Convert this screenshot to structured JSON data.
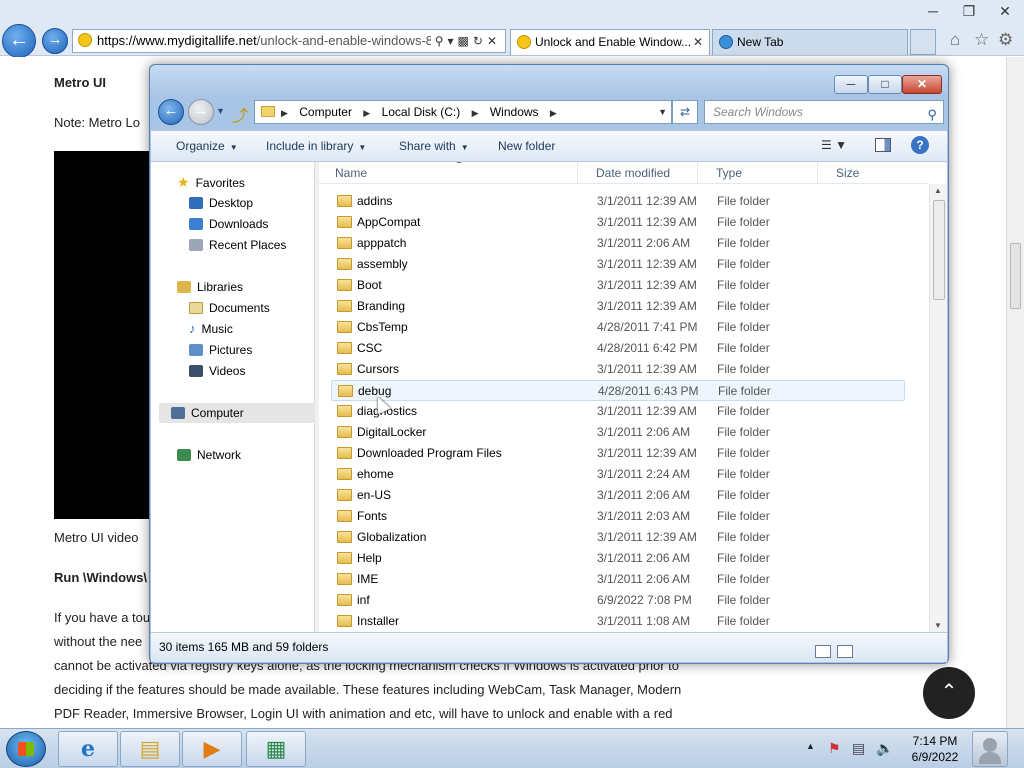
{
  "browser": {
    "address_domain": "https://www.mydigitallife.net",
    "address_path": "/unlock-and-enable-windows-8",
    "tabs": [
      {
        "label": "Unlock and Enable Window..."
      },
      {
        "label": "New Tab"
      }
    ]
  },
  "page": {
    "heading": "Metro UI",
    "note": "Note: Metro Lo",
    "video_caption": "Metro UI video",
    "run_text": "Run \\Windows\\",
    "para1": "If you have a tou",
    "para2": "without the nee",
    "para3": "cannot be activated via registry keys alone, as the locking mechanism checks if Windows is activated prior to",
    "para4": "deciding if the features should be made available. These features including WebCam, Task Manager, Modern",
    "para5": "PDF Reader, Immersive Browser, Login UI with animation and etc, will have to unlock and enable with a red"
  },
  "explorer": {
    "breadcrumb": [
      "Computer",
      "Local Disk (C:)",
      "Windows"
    ],
    "search_placeholder": "Search Windows",
    "toolbar": {
      "organize": "Organize",
      "include_in_library": "Include in library",
      "share_with": "Share with",
      "new_folder": "New folder"
    },
    "nav": {
      "favorites": "Favorites",
      "desktop": "Desktop",
      "downloads": "Downloads",
      "recent_places": "Recent Places",
      "libraries": "Libraries",
      "documents": "Documents",
      "music": "Music",
      "pictures": "Pictures",
      "videos": "Videos",
      "computer": "Computer",
      "network": "Network"
    },
    "columns": {
      "name": "Name",
      "date_modified": "Date modified",
      "type": "Type",
      "size": "Size"
    },
    "files": [
      {
        "name": "addins",
        "date": "3/1/2011 12:39 AM",
        "type": "File folder"
      },
      {
        "name": "AppCompat",
        "date": "3/1/2011 12:39 AM",
        "type": "File folder"
      },
      {
        "name": "apppatch",
        "date": "3/1/2011 2:06 AM",
        "type": "File folder"
      },
      {
        "name": "assembly",
        "date": "3/1/2011 12:39 AM",
        "type": "File folder"
      },
      {
        "name": "Boot",
        "date": "3/1/2011 12:39 AM",
        "type": "File folder"
      },
      {
        "name": "Branding",
        "date": "3/1/2011 12:39 AM",
        "type": "File folder"
      },
      {
        "name": "CbsTemp",
        "date": "4/28/2011 7:41 PM",
        "type": "File folder"
      },
      {
        "name": "CSC",
        "date": "4/28/2011 6:42 PM",
        "type": "File folder"
      },
      {
        "name": "Cursors",
        "date": "3/1/2011 12:39 AM",
        "type": "File folder"
      },
      {
        "name": "debug",
        "date": "4/28/2011 6:43 PM",
        "type": "File folder"
      },
      {
        "name": "diagnostics",
        "date": "3/1/2011 12:39 AM",
        "type": "File folder"
      },
      {
        "name": "DigitalLocker",
        "date": "3/1/2011 2:06 AM",
        "type": "File folder"
      },
      {
        "name": "Downloaded Program Files",
        "date": "3/1/2011 12:39 AM",
        "type": "File folder"
      },
      {
        "name": "ehome",
        "date": "3/1/2011 2:24 AM",
        "type": "File folder"
      },
      {
        "name": "en-US",
        "date": "3/1/2011 2:06 AM",
        "type": "File folder"
      },
      {
        "name": "Fonts",
        "date": "3/1/2011 2:03 AM",
        "type": "File folder"
      },
      {
        "name": "Globalization",
        "date": "3/1/2011 12:39 AM",
        "type": "File folder"
      },
      {
        "name": "Help",
        "date": "3/1/2011 2:06 AM",
        "type": "File folder"
      },
      {
        "name": "IME",
        "date": "3/1/2011 2:06 AM",
        "type": "File folder"
      },
      {
        "name": "inf",
        "date": "6/9/2022 7:08 PM",
        "type": "File folder"
      },
      {
        "name": "Installer",
        "date": "3/1/2011 1:08 AM",
        "type": "File folder"
      }
    ],
    "hovered_file": "debug",
    "status": "30 items 165 MB and 59 folders"
  },
  "taskbar": {
    "time": "7:14 PM",
    "date": "6/9/2022"
  }
}
